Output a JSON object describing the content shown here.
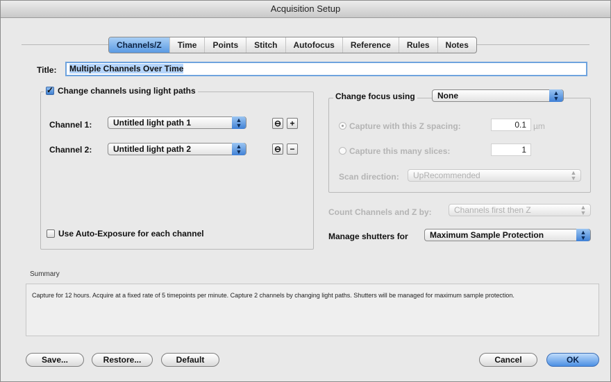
{
  "window": {
    "title": "Acquisition Setup"
  },
  "tabs": [
    {
      "label": "Channels/Z",
      "active": true
    },
    {
      "label": "Time",
      "active": false
    },
    {
      "label": "Points",
      "active": false
    },
    {
      "label": "Stitch",
      "active": false
    },
    {
      "label": "Autofocus",
      "active": false
    },
    {
      "label": "Reference",
      "active": false
    },
    {
      "label": "Rules",
      "active": false
    },
    {
      "label": "Notes",
      "active": false
    }
  ],
  "title_field": {
    "label": "Title:",
    "value": "Multiple Channels Over Time"
  },
  "channels": {
    "checkbox_label": "Change channels using light paths",
    "checked": true,
    "rows": [
      {
        "label": "Channel 1:",
        "value": "Untitled light path 1",
        "btn1": "⊖",
        "btn2": "+"
      },
      {
        "label": "Channel 2:",
        "value": "Untitled light path 2",
        "btn1": "⊖",
        "btn2": "−"
      }
    ],
    "auto_exposure_label": "Use Auto-Exposure for each channel"
  },
  "focus": {
    "label": "Change focus using",
    "value": "None",
    "z_spacing_label": "Capture with this Z spacing:",
    "z_spacing_value": "0.1",
    "z_spacing_unit": "µm",
    "slices_label": "Capture this many slices:",
    "slices_value": "1",
    "scan_direction_label": "Scan direction:",
    "scan_direction_value": "UpRecommended"
  },
  "count": {
    "label": "Count Channels and Z by:",
    "value": "Channels first then Z"
  },
  "shutters": {
    "label": "Manage shutters for",
    "value": "Maximum Sample Protection"
  },
  "summary": {
    "label": "Summary",
    "text": "Capture for 12 hours. Acquire at a fixed rate of 5 timepoints per minute. Capture 2 channels by changing light paths. Shutters will be managed for maximum sample protection."
  },
  "buttons": {
    "save": "Save...",
    "restore": "Restore...",
    "default": "Default",
    "cancel": "Cancel",
    "ok": "OK"
  }
}
